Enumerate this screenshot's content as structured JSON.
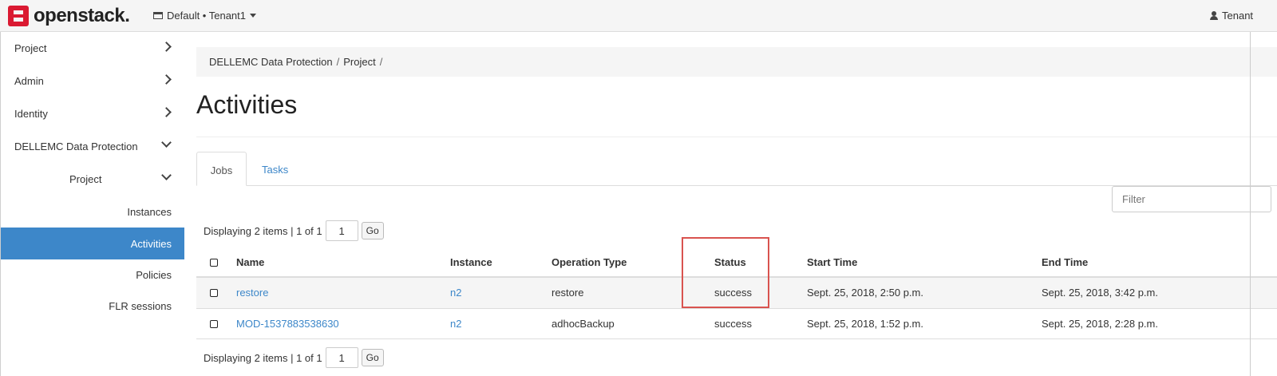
{
  "topbar": {
    "brand": "openstack.",
    "tenant_label": "Default • Tenant1",
    "user_label": "Tenant"
  },
  "sidebar": {
    "items": [
      {
        "label": "Project"
      },
      {
        "label": "Admin"
      },
      {
        "label": "Identity"
      },
      {
        "label": "DELLEMC Data Protection"
      },
      {
        "label": "Project"
      },
      {
        "label": "Instances"
      },
      {
        "label": "Activities",
        "active": true
      },
      {
        "label": "Policies"
      },
      {
        "label": "FLR sessions"
      }
    ]
  },
  "breadcrumb": {
    "items": [
      "DELLEMC Data Protection",
      "Project"
    ],
    "separator": "/"
  },
  "page": {
    "title": "Activities"
  },
  "tabs": [
    {
      "label": "Jobs",
      "active": true
    },
    {
      "label": "Tasks",
      "active": false
    }
  ],
  "filter": {
    "placeholder": "Filter"
  },
  "pagination": {
    "summary": "Displaying 2 items | 1 of 1",
    "page_value": "1",
    "go_label": "Go"
  },
  "table": {
    "columns": [
      "Name",
      "Instance",
      "Operation Type",
      "Status",
      "Start Time",
      "End Time"
    ],
    "rows": [
      {
        "name": "restore",
        "instance": "n2",
        "operation_type": "restore",
        "status": "success",
        "start_time": "Sept. 25, 2018, 2:50 p.m.",
        "end_time": "Sept. 25, 2018, 3:42 p.m."
      },
      {
        "name": "MOD-1537883538630",
        "instance": "n2",
        "operation_type": "adhocBackup",
        "status": "success",
        "start_time": "Sept. 25, 2018, 1:52 p.m.",
        "end_time": "Sept. 25, 2018, 2:28 p.m."
      }
    ]
  },
  "colors": {
    "accent": "#3d87c9",
    "brand_red": "#da1a32",
    "highlight_box": "#d9534f"
  },
  "icons": [
    "openstack-logo-icon",
    "tenant-icon",
    "caret-down-icon",
    "user-icon",
    "chevron-right-icon",
    "chevron-down-icon",
    "checkbox-icon"
  ]
}
